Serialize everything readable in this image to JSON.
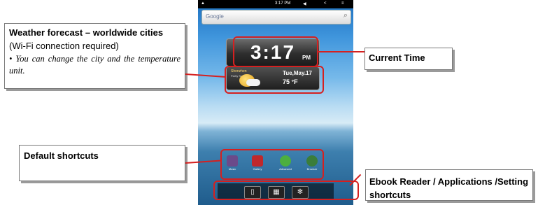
{
  "callouts": {
    "weather": {
      "title_bold": "Weather forecast – worldwide cities",
      "title_rest": " (Wi-Fi connection required)",
      "note": "• You can change the city and the temperature unit."
    },
    "time": "Current Time",
    "shortcuts": "Default shortcuts",
    "ebook": "Ebook Reader / Applications /Setting shortcuts"
  },
  "screen": {
    "statusbar": {
      "time": "3:17 PM"
    },
    "search_placeholder": "Google",
    "clock": {
      "time": "3:17",
      "ampm": "PM"
    },
    "weather": {
      "city": "Shenzhen",
      "condition": "Partly Sunny",
      "date": "Tue,May.17",
      "temp": "75 °F"
    },
    "apps": [
      {
        "label": "Music",
        "color": "#6b4a8a"
      },
      {
        "label": "Gallery",
        "color": "#c0282b"
      },
      {
        "label": "Advanced",
        "color": "#4caf3f"
      },
      {
        "label": "Browser",
        "color": "#3a7d3a"
      }
    ],
    "dock": [
      "ebook-icon",
      "apps-grid-icon",
      "settings-gear-icon"
    ]
  },
  "colors": {
    "highlight": "#d52020"
  }
}
